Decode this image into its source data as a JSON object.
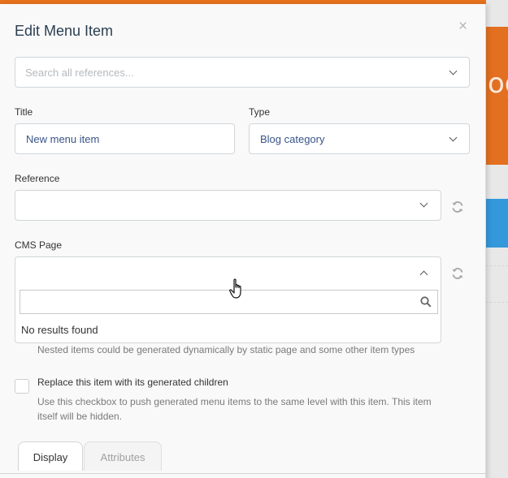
{
  "background": {
    "partial_text": "og"
  },
  "modal": {
    "title": "Edit Menu Item",
    "close_glyph": "×"
  },
  "search": {
    "placeholder": "Search all references..."
  },
  "title_field": {
    "label": "Title",
    "value": "New menu item"
  },
  "type_field": {
    "label": "Type",
    "value": "Blog category"
  },
  "reference_field": {
    "label": "Reference",
    "value": ""
  },
  "cms_page_field": {
    "label": "CMS Page",
    "value": "",
    "dropdown": {
      "search_value": "",
      "no_results": "No results found"
    }
  },
  "nested_help": "Nested items could be generated dynamically by static page and some other item types",
  "replace_checkbox": {
    "label": "Replace this item with its generated children",
    "checked": false,
    "help_line1": "Use this checkbox to push generated menu items to the same level with this item. This item",
    "help_line2": "itself will be hidden."
  },
  "tabs": [
    {
      "label": "Display",
      "active": true
    },
    {
      "label": "Attributes",
      "active": false
    }
  ],
  "icons": {
    "close": "close-icon",
    "chevron": "chevron-down-icon",
    "refresh": "refresh-icon",
    "search": "search-icon",
    "cursor": "hand-pointer-icon"
  },
  "colors": {
    "header_orange": "#e9731f",
    "accent_blue": "#3498db",
    "value_text": "#385487",
    "title_text": "#2b3e50"
  }
}
